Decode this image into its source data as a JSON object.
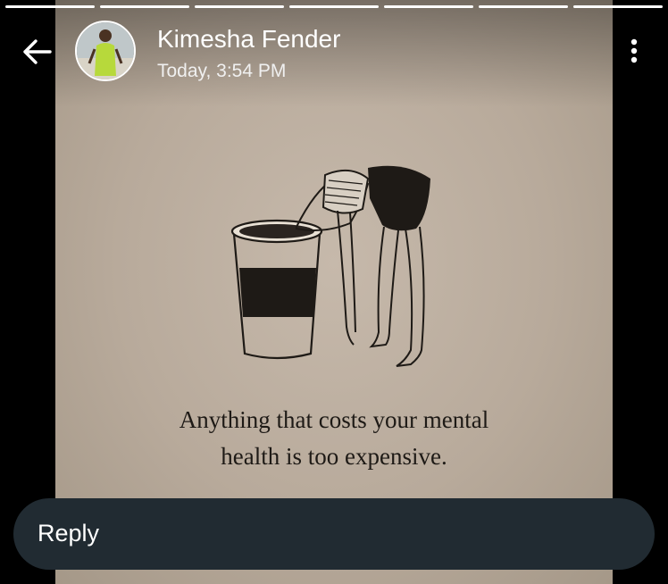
{
  "story": {
    "segment_count": 7,
    "caption_line1": "Anything that costs your mental",
    "caption_line2": "health  is too expensive."
  },
  "header": {
    "back_icon": "arrow-left-icon",
    "sender_name": "Kimesha Fender",
    "timestamp": "Today, 3:54 PM",
    "more_icon": "more-vertical-icon"
  },
  "reply": {
    "label": "Reply"
  },
  "colors": {
    "background": "#000000",
    "reply_bar": "#212b32",
    "text": "#ffffff",
    "paper": "#bcae9f",
    "ink": "#1e1a16"
  }
}
